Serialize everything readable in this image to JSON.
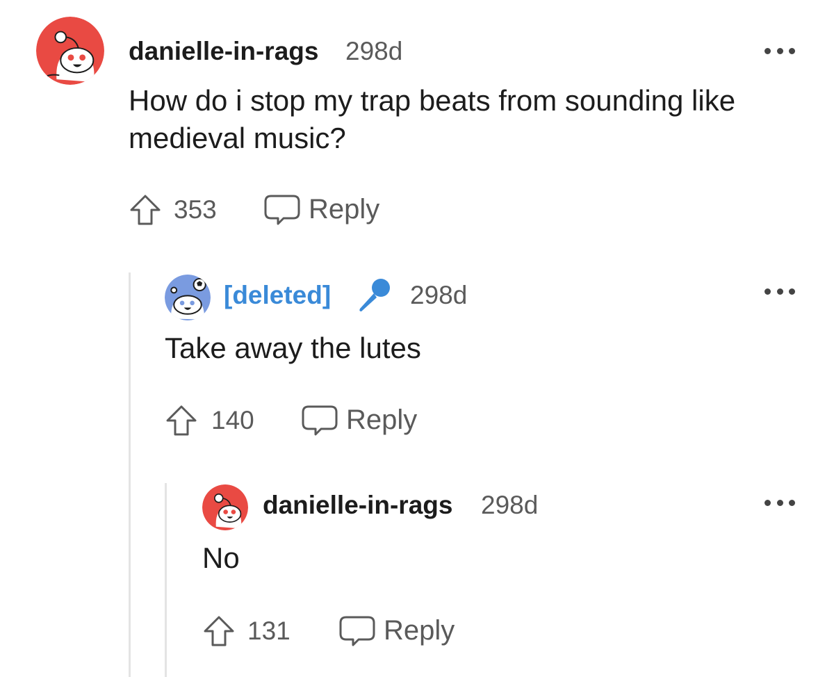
{
  "colors": {
    "avatar_red": "#e94a43",
    "avatar_blue": "#7a9be0",
    "deleted_blue": "#3a8ad8",
    "meta_gray": "#5a5a5a",
    "thread_line": "#e4e4e4"
  },
  "comments": [
    {
      "avatar_icon": "snoo-avatar-red-icon",
      "username": "danielle-in-rags",
      "age": "298d",
      "body": "How do i stop my trap beats from sounding like medieval music?",
      "upvotes": "353",
      "reply_label": "Reply"
    },
    {
      "avatar_icon": "snoo-avatar-blue-icon",
      "username": "[deleted]",
      "flair_icon": "microphone-icon",
      "age": "298d",
      "body": "Take away the lutes",
      "upvotes": "140",
      "reply_label": "Reply"
    },
    {
      "avatar_icon": "snoo-avatar-red-icon",
      "username": "danielle-in-rags",
      "age": "298d",
      "body": "No",
      "upvotes": "131",
      "reply_label": "Reply"
    }
  ]
}
